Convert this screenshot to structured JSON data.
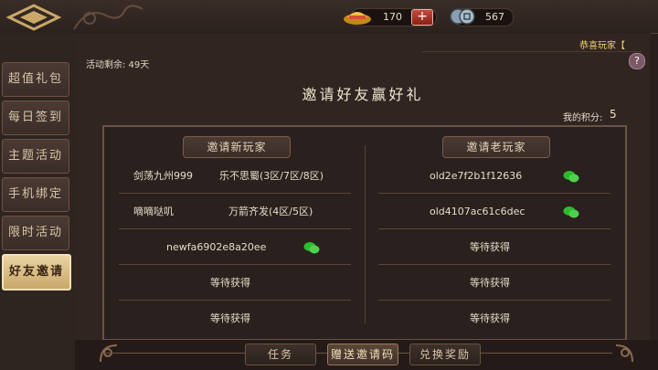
{
  "header": {
    "gold_value": "170",
    "plus_label": "+",
    "coin_value": "567"
  },
  "sidebar": {
    "items": [
      {
        "label": "超值礼包"
      },
      {
        "label": "每日签到"
      },
      {
        "label": "主题活动"
      },
      {
        "label": "手机绑定"
      },
      {
        "label": "限时活动"
      },
      {
        "label": "好友邀请"
      }
    ],
    "active_index": 5
  },
  "main": {
    "marquee": "恭喜玩家【",
    "remaining": "活动剩余: 49天",
    "help": "?",
    "title": "邀请好友赢好礼",
    "score_label": "我的积分:",
    "score_value": "5"
  },
  "new_players": {
    "header": "邀请新玩家",
    "rows": [
      {
        "name": "剑荡九州999",
        "server": "乐不思蜀(3区/7区/8区)",
        "wechat": false
      },
      {
        "name": "嘀嘀哒叽",
        "server": "万箭齐发(4区/5区)",
        "wechat": false
      },
      {
        "name": "newfa6902e8a20ee",
        "server": "",
        "wechat": true
      },
      {
        "name": "等待获得",
        "server": "",
        "wechat": false
      },
      {
        "name": "等待获得",
        "server": "",
        "wechat": false
      }
    ]
  },
  "old_players": {
    "header": "邀请老玩家",
    "rows": [
      {
        "name": "old2e7f2b1f12636",
        "wechat": true
      },
      {
        "name": "old4107ac61c6dec",
        "wechat": true
      },
      {
        "name": "等待获得",
        "wechat": false
      },
      {
        "name": "等待获得",
        "wechat": false
      },
      {
        "name": "等待获得",
        "wechat": false
      }
    ]
  },
  "tabs": [
    {
      "label": "任务"
    },
    {
      "label": "赠送邀请码"
    },
    {
      "label": "兑换奖励"
    }
  ],
  "active_tab": 1,
  "colors": {
    "accent": "#e8d3a2",
    "wechat_green": "#2dbb2d"
  }
}
